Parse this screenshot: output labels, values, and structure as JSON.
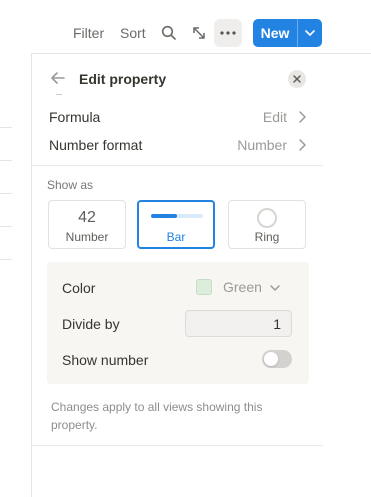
{
  "toolbar": {
    "filter_label": "Filter",
    "sort_label": "Sort",
    "search_icon": "search-icon",
    "expand_icon": "expand-icon",
    "more_icon": "more-horizontal-icon",
    "new_label": "New",
    "new_dropdown_icon": "chevron-down-icon",
    "accent_color": "#2383e2"
  },
  "panel": {
    "title": "Edit property",
    "back_icon": "arrow-left-icon",
    "close_icon": "close-icon",
    "rows": {
      "formula": {
        "label": "Formula",
        "value": "Edit"
      },
      "number_format": {
        "label": "Number format",
        "value": "Number"
      }
    },
    "show_as": {
      "section_label": "Show as",
      "options": [
        {
          "label": "Number",
          "preview": "42",
          "selected": false
        },
        {
          "label": "Bar",
          "selected": true,
          "preview_fill_fraction": 0.5
        },
        {
          "label": "Ring",
          "selected": false
        }
      ]
    },
    "settings": {
      "color_label": "Color",
      "color_value": "Green",
      "color_hex": "#dbeddb",
      "divide_label": "Divide by",
      "divide_value": "1",
      "show_number_label": "Show number",
      "show_number_on": false
    },
    "footnote": "Changes apply to all views showing this property."
  }
}
